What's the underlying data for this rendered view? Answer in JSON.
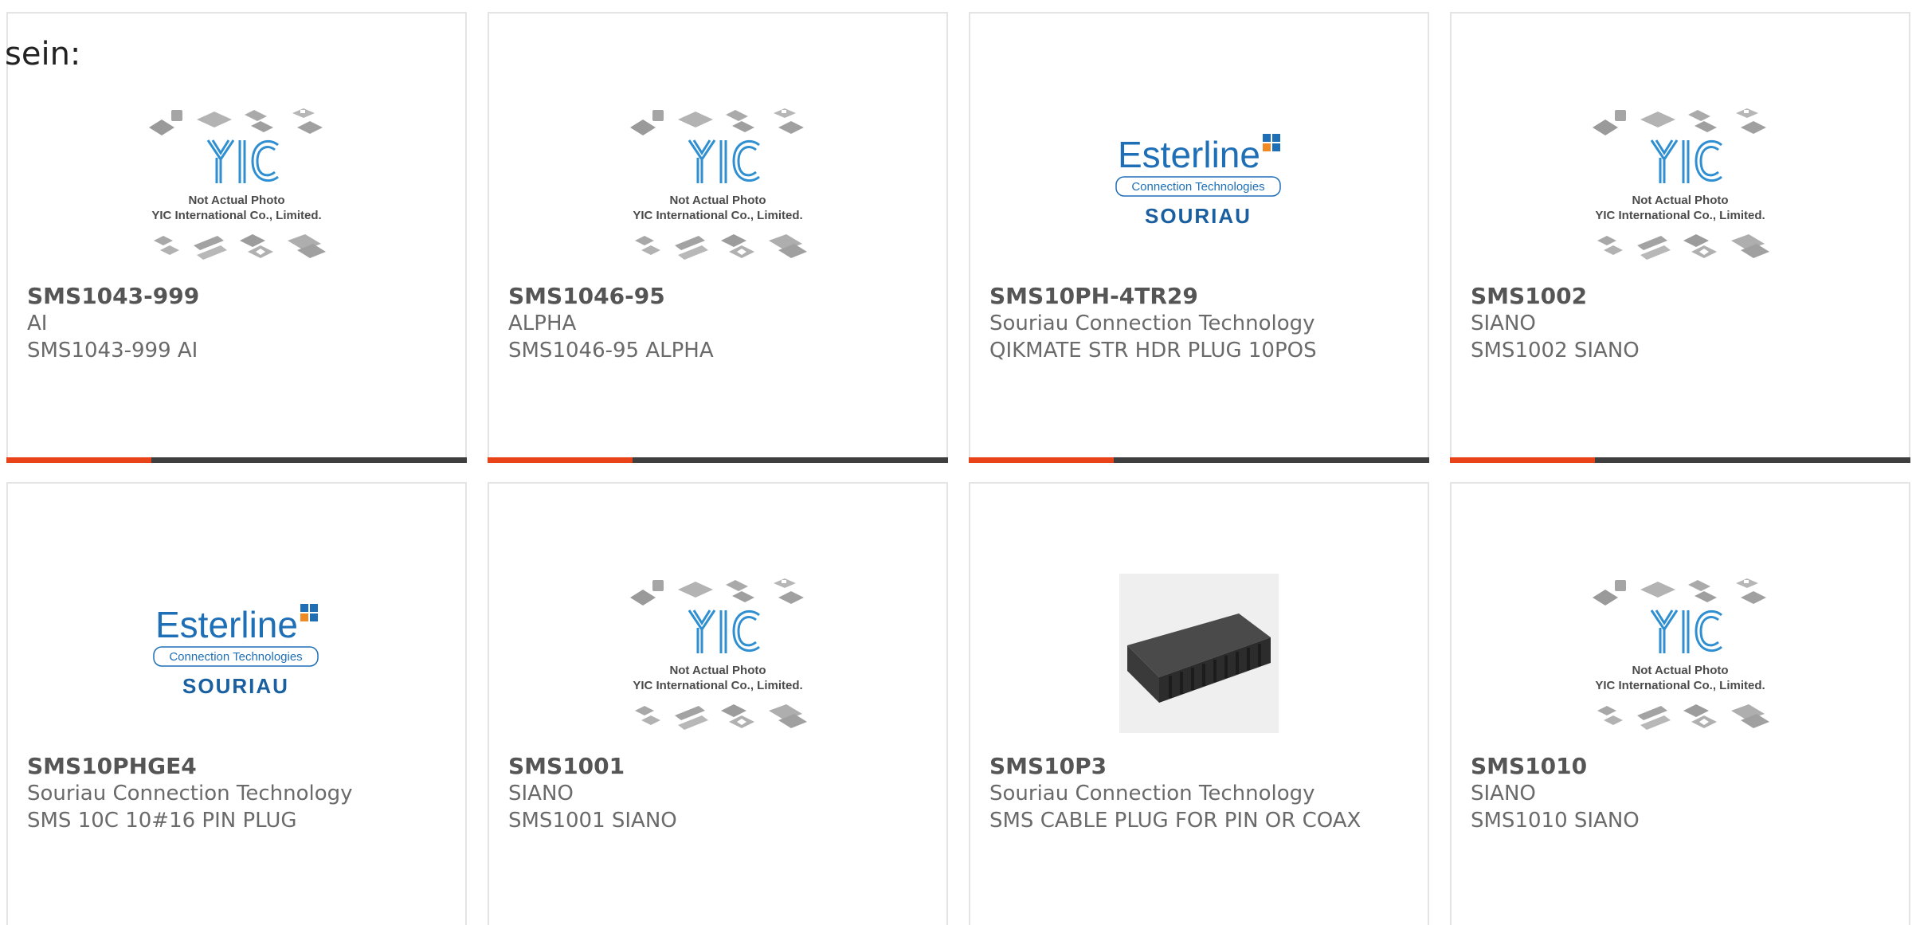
{
  "lead_text": "sein:",
  "brand_colors": {
    "accent": "#e84319",
    "bar_dark": "#3f3f3f",
    "esterline_blue": "#1f6fb7",
    "souriau_blue": "#1a5fa0"
  },
  "placeholder_image": {
    "logo": "YIC",
    "line1": "Not Actual Photo",
    "line2": "YIC International Co., Limited."
  },
  "esterline_logo": {
    "brand": "Esterline",
    "tagline": "Connection Technologies",
    "sub": "SOURIAU"
  },
  "products": [
    {
      "part_number": "SMS1043-999",
      "manufacturer": "AI",
      "description": "SMS1043-999 AI",
      "image": "yic-placeholder"
    },
    {
      "part_number": "SMS1046-95",
      "manufacturer": "ALPHA",
      "description": "SMS1046-95 ALPHA",
      "image": "yic-placeholder"
    },
    {
      "part_number": "SMS10PH-4TR29",
      "manufacturer": "Souriau Connection Technology",
      "description": "QIKMATE STR HDR PLUG 10POS",
      "image": "esterline-souriau-logo"
    },
    {
      "part_number": "SMS1002",
      "manufacturer": "SIANO",
      "description": "SMS1002 SIANO",
      "image": "yic-placeholder"
    },
    {
      "part_number": "SMS10PHGE4",
      "manufacturer": "Souriau Connection Technology",
      "description": "SMS 10C 10#16 PIN PLUG",
      "image": "esterline-souriau-logo"
    },
    {
      "part_number": "SMS1001",
      "manufacturer": "SIANO",
      "description": "SMS1001 SIANO",
      "image": "yic-placeholder"
    },
    {
      "part_number": "SMS10P3",
      "manufacturer": "Souriau Connection Technology",
      "description": "SMS CABLE PLUG FOR PIN OR COAX",
      "image": "connector-photo"
    },
    {
      "part_number": "SMS1010",
      "manufacturer": "SIANO",
      "description": "SMS1010 SIANO",
      "image": "yic-placeholder"
    }
  ]
}
